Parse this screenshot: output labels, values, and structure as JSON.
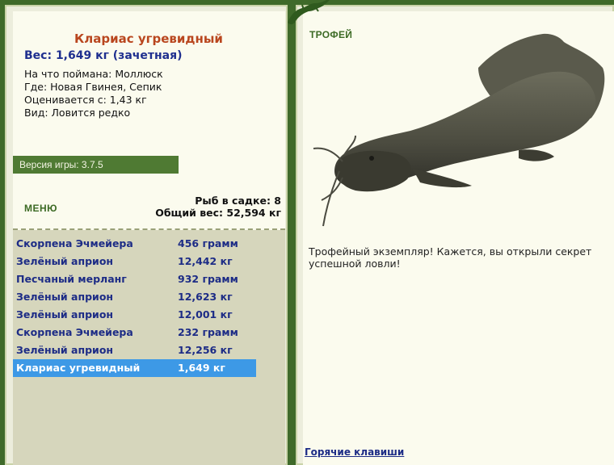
{
  "fish": {
    "name": "Клариас угревидный",
    "weight_line": "Вес: 1,649 кг (зачетная)",
    "caught_on": "На что поймана: Моллюск",
    "location": "Где: Новая Гвинея, Сепик",
    "rated_from": "Оценивается с: 1,43 кг",
    "kind": "Вид: Ловится редко"
  },
  "version": "Версия игры: 3.7.5",
  "menu_label": "МЕНЮ",
  "stats": {
    "fish_count": "Рыб в садке: 8",
    "total_weight": "Общий вес: 52,594 кг"
  },
  "catch_list": [
    {
      "name": "Скорпена Эчмейера",
      "weight": "456 грамм",
      "selected": false
    },
    {
      "name": "Зелёный априон",
      "weight": "12,442 кг",
      "selected": false
    },
    {
      "name": "Песчаный мерланг",
      "weight": "932 грамм",
      "selected": false
    },
    {
      "name": "Зелёный априон",
      "weight": "12,623 кг",
      "selected": false
    },
    {
      "name": "Зелёный априон",
      "weight": "12,001 кг",
      "selected": false
    },
    {
      "name": "Скорпена Эчмейера",
      "weight": "232 грамм",
      "selected": false
    },
    {
      "name": "Зелёный априон",
      "weight": "12,256 кг",
      "selected": false
    },
    {
      "name": "Клариас угревидный",
      "weight": "1,649 кг",
      "selected": true
    }
  ],
  "trophy": {
    "label": "ТРОФЕЙ",
    "text": "Трофейный экземпляр! Кажется, вы открыли секрет успешной ловли!"
  },
  "hotkeys_link": "Горячие клавиши",
  "colors": {
    "frame_green": "#3f6a2a",
    "panel_bg": "#fbfbee",
    "list_bg": "#d6d6bc",
    "selected_row": "#3d99e6",
    "fish_name": "#b9461e",
    "navy_text": "#1d2c86"
  }
}
